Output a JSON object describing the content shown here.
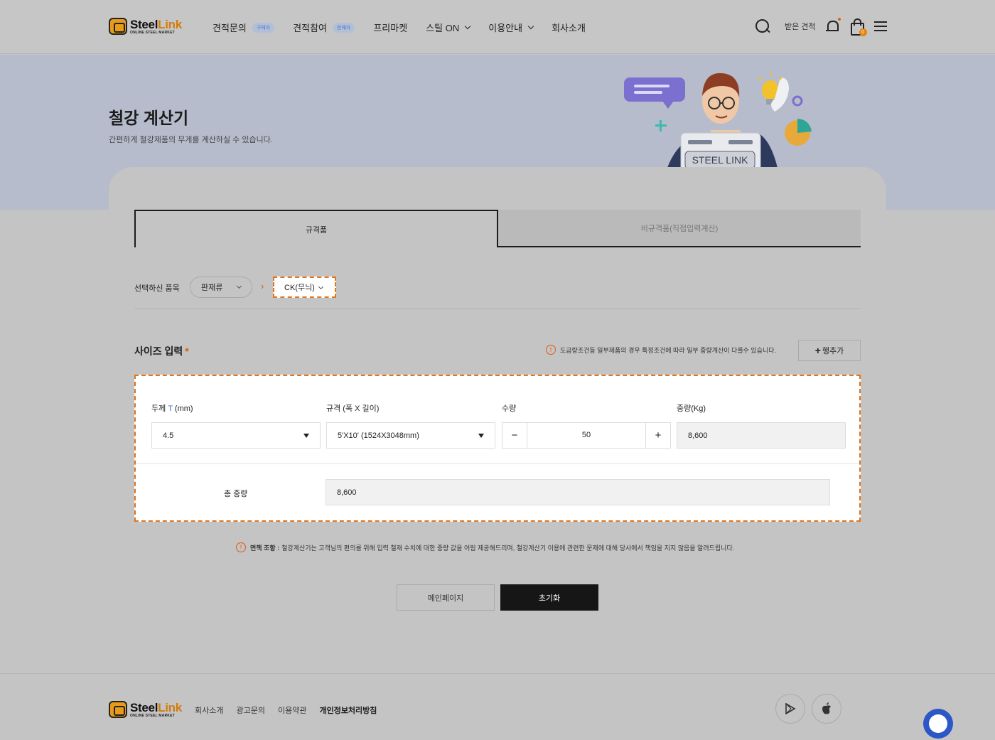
{
  "header": {
    "logo_name_a": "Steel",
    "logo_name_b": "Link",
    "logo_sub": "ONLINE STEEL MARKET",
    "nav": [
      {
        "label": "견적문의",
        "badge": "구매자"
      },
      {
        "label": "견적참여",
        "badge": "판매자"
      },
      {
        "label": "프리마켓"
      },
      {
        "label": "스틸 ON"
      },
      {
        "label": "이용안내"
      },
      {
        "label": "회사소개"
      }
    ],
    "received_quotes": "받은 견적",
    "cart_count": "0"
  },
  "hero": {
    "title": "철강 계산기",
    "subtitle": "간편하게 철강제품의 무게를 계산하실 수 있습니다.",
    "board_text": "STEEL LINK"
  },
  "tabs": {
    "standard": "규격품",
    "nonstandard": "비규격품(직접입력계산)"
  },
  "selection": {
    "label": "선택하신 품목",
    "category": "판재류",
    "arrow": "›",
    "item": "CK(무늬)"
  },
  "size": {
    "title": "사이즈 입력",
    "required": "*",
    "note_icon": "!",
    "note": "도금량조건등 일부제품의 경우 특정조건에 따라 일부 중량계산이 다를수 있습니다.",
    "add_row_plus": "+",
    "add_row": "행추가"
  },
  "calc": {
    "thickness_label": "두께",
    "thickness_t": "T",
    "thickness_unit": "(mm)",
    "thickness_value": "4.5",
    "spec_label": "규격 (폭 X 길이)",
    "spec_value": "5'X10' (1524X3048mm)",
    "qty_label": "수량",
    "qty_minus": "−",
    "qty_value": "50",
    "qty_plus": "+",
    "weight_label": "중량(Kg)",
    "weight_value": "8,600",
    "total_label": "총 중량",
    "total_value": "8,600"
  },
  "disclaimer": {
    "icon": "!",
    "title": "면책 조항 :",
    "text": "철강계산기는 고객님의 편의를 위해 입력 철재 수치에 대한 중량 값을 어림 제공해드리며, 철강계산기 이용에 관련한 문제에 대해 당사에서 책임을 지지 않음을 알려드립니다."
  },
  "buttons": {
    "main": "메인페이지",
    "reset": "초기화"
  },
  "footer": {
    "links": [
      "회사소개",
      "광고문의",
      "이용약관",
      "개인정보처리방침"
    ]
  },
  "colors": {
    "accent_orange": "#e2741a",
    "primary_dark": "#161616",
    "chat_blue": "#2b58c6"
  }
}
